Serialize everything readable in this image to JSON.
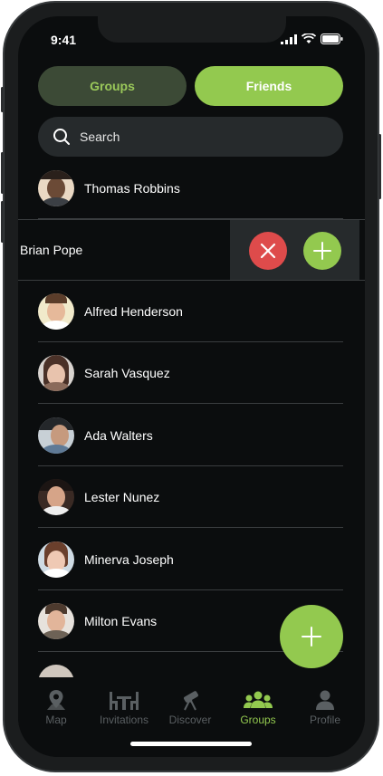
{
  "status": {
    "time": "9:41"
  },
  "segments": {
    "groups": "Groups",
    "friends": "Friends",
    "active": "Friends"
  },
  "search": {
    "placeholder": "Search"
  },
  "friends": [
    {
      "name": "Thomas Robbins"
    },
    {
      "name": "Brian Pope"
    },
    {
      "name": "Alfred Henderson"
    },
    {
      "name": "Sarah Vasquez"
    },
    {
      "name": "Ada Walters"
    },
    {
      "name": "Lester Nunez"
    },
    {
      "name": "Minerva Joseph"
    },
    {
      "name": "Milton Evans"
    }
  ],
  "tabs": [
    {
      "label": "Map",
      "icon": "map-pin-icon"
    },
    {
      "label": "Invitations",
      "icon": "dining-table-icon"
    },
    {
      "label": "Discover",
      "icon": "telescope-icon"
    },
    {
      "label": "Groups",
      "icon": "group-icon",
      "active": true
    },
    {
      "label": "Profile",
      "icon": "user-icon"
    }
  ],
  "colors": {
    "accent": "#93c94f",
    "danger": "#de4b4b",
    "background": "#0b0d0e",
    "surface": "#262a2c"
  }
}
